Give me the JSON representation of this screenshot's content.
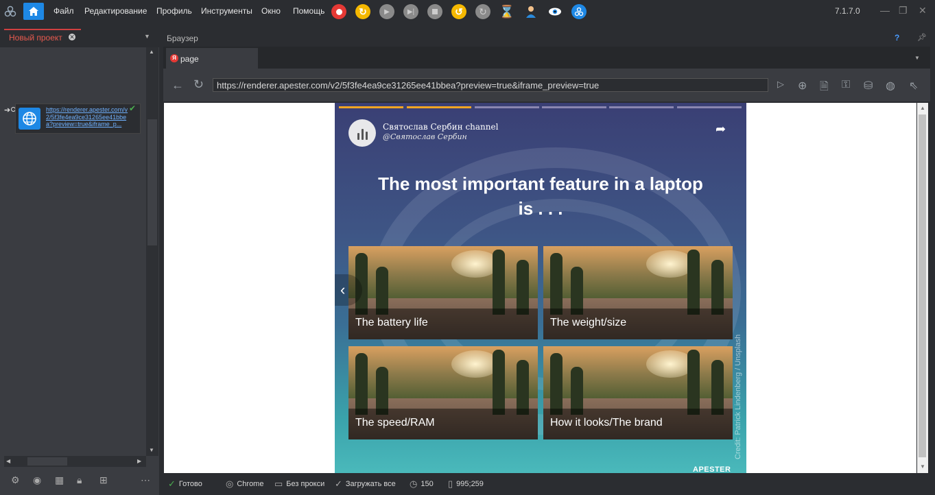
{
  "menu": {
    "items": [
      "Файл",
      "Редактирование",
      "Профиль",
      "Инструменты",
      "Окно",
      "Помощь"
    ]
  },
  "toolbar": {
    "icons": [
      "record-icon",
      "refresh-icon",
      "play-icon",
      "step-icon",
      "stop-icon",
      "undo-icon",
      "redo-icon",
      "hourglass-icon",
      "user-icon",
      "eye-icon",
      "network-icon"
    ]
  },
  "version": "7.1.7.0",
  "project": {
    "tab_label": "Новый проект",
    "node_link": "https://renderer.apester.com/v2/5f3fe4ea9ce31265ee41bbea?preview=true&iframe_p..."
  },
  "browser": {
    "panel_title": "Браузер",
    "help": "?",
    "tab_label": "page",
    "tab_icon_letter": "Я",
    "url": "https://renderer.apester.com/v2/5f3fe4ea9ce31265ee41bbea?preview=true&iframe_preview=true"
  },
  "content": {
    "channel_name": "Святослав Сербин channel",
    "channel_handle": "@Святослав Сербин",
    "question": "The most important feature in a laptop is . . .",
    "options": [
      "The battery life",
      "The weight/size",
      "The speed/RAM",
      "How it looks/The brand"
    ],
    "credit": "Credit: Patrick Lindenberg / Unsplash",
    "brand": "APESTER",
    "progress_active_color": "#f5a623",
    "progress_inactive_color": "#8a86b0"
  },
  "status": {
    "state": "Готово",
    "browser": "Chrome",
    "proxy": "Без прокси",
    "load": "Загружать все",
    "timer": "150",
    "coords": "995;259"
  }
}
